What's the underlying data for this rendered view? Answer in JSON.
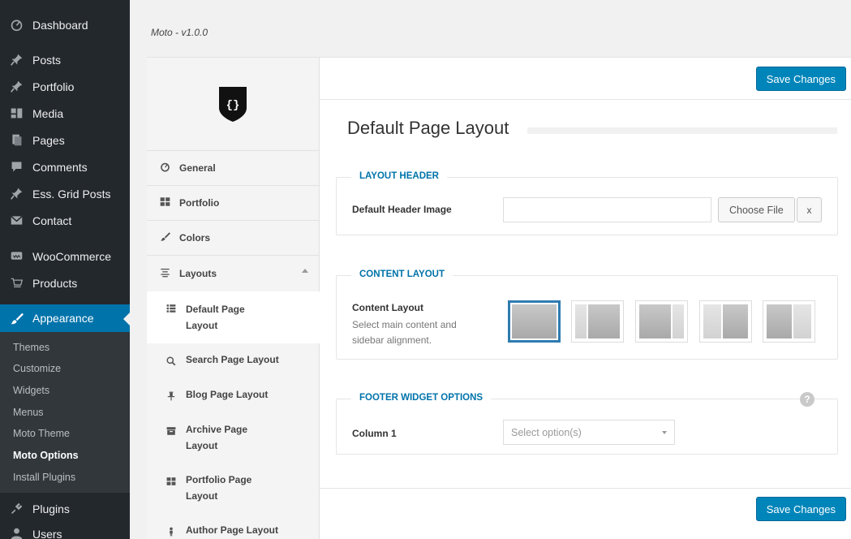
{
  "adminmenu": {
    "items": [
      {
        "label": "Dashboard",
        "icon": "dashboard-icon"
      },
      {
        "label": "Posts",
        "icon": "pin-icon"
      },
      {
        "label": "Portfolio",
        "icon": "pin-icon"
      },
      {
        "label": "Media",
        "icon": "media-icon"
      },
      {
        "label": "Pages",
        "icon": "page-icon"
      },
      {
        "label": "Comments",
        "icon": "comment-icon"
      },
      {
        "label": "Ess. Grid Posts",
        "icon": "pin-icon"
      },
      {
        "label": "Contact",
        "icon": "mail-icon"
      },
      {
        "label": "WooCommerce",
        "icon": "woo-icon"
      },
      {
        "label": "Products",
        "icon": "cart-icon"
      },
      {
        "label": "Appearance",
        "icon": "brush-icon"
      },
      {
        "label": "Plugins",
        "icon": "plug-icon"
      },
      {
        "label": "Users",
        "icon": "user-icon"
      }
    ],
    "submenu": [
      "Themes",
      "Customize",
      "Widgets",
      "Menus",
      "Moto Theme",
      "Moto Options",
      "Install Plugins"
    ]
  },
  "header": {
    "version": "Moto - v1.0.0"
  },
  "optnav": {
    "items": [
      {
        "label": "General"
      },
      {
        "label": "Portfolio"
      },
      {
        "label": "Colors"
      },
      {
        "label": "Layouts"
      }
    ],
    "sub_items": [
      {
        "label": "Default Page Layout"
      },
      {
        "label": "Search Page Layout"
      },
      {
        "label": "Blog Page Layout"
      },
      {
        "label": "Archive Page Layout"
      },
      {
        "label": "Portfolio Page Layout"
      },
      {
        "label": "Author Page Layout"
      }
    ]
  },
  "main": {
    "save_label": "Save Changes",
    "title": "Default Page Layout",
    "layout_header": {
      "legend": "LAYOUT HEADER",
      "label": "Default Header Image",
      "choose_label": "Choose File",
      "clear_label": "x",
      "value": ""
    },
    "content_layout": {
      "legend": "CONTENT LAYOUT",
      "label": "Content Layout",
      "description": "Select main content and sidebar alignment.",
      "options": [
        "full-width",
        "left-sidebar",
        "right-sidebar",
        "left-sidebar-wide",
        "right-sidebar-wide"
      ],
      "selected": "full-width"
    },
    "footer": {
      "legend": "FOOTER WIDGET OPTIONS",
      "label": "Column 1",
      "placeholder": "Select option(s)",
      "help": "?"
    }
  },
  "colors": {
    "accent": "#0073aa",
    "button": "#0085ba",
    "sidebar": "#23282d"
  }
}
